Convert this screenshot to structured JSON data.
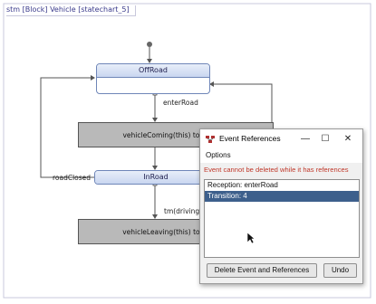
{
  "diagram": {
    "frame_label": "stm [Block] Vehicle [statechart_5]",
    "states": [
      {
        "name": "OffRoad"
      },
      {
        "name": "InRoad"
      }
    ],
    "actions": [
      {
        "text": "vehicleComing(this) to itsMonit"
      },
      {
        "text": "vehicleLeaving(this) to itsMonit"
      }
    ],
    "transitions": {
      "enter_road": "enterRoad",
      "road_closed": "roadClosed",
      "tm": "tm(drivingTir"
    }
  },
  "dialog": {
    "title": "Event References",
    "window_buttons": {
      "minimize": "—",
      "maximize": "☐",
      "close": "✕"
    },
    "menu": {
      "options": "Options"
    },
    "error_message": "Event cannot be deleted while it has references",
    "references": [
      {
        "label": "Reception: enterRoad",
        "selected": false
      },
      {
        "label": "Transition: 4",
        "selected": true
      }
    ],
    "buttons": {
      "delete_label": "Delete Event and References",
      "undo_label": "Undo"
    }
  }
}
